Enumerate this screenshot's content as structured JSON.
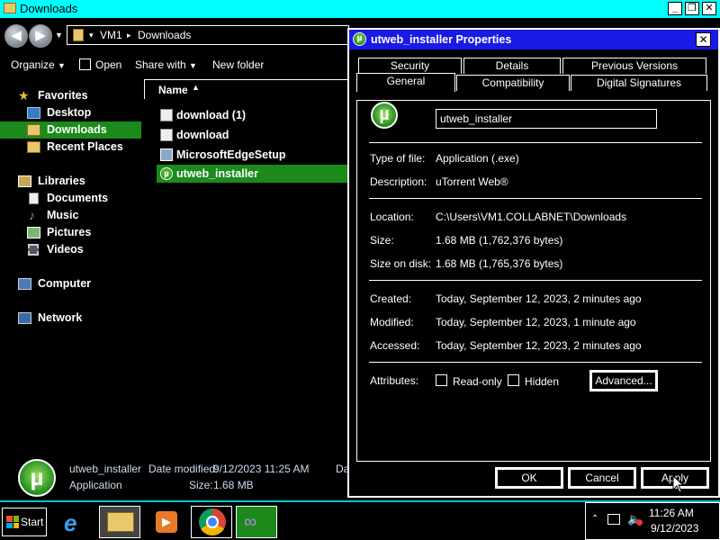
{
  "explorer": {
    "title": "Downloads",
    "breadcrumb": [
      "VM1",
      "Downloads"
    ],
    "toolbar": {
      "organize": "Organize",
      "open": "Open",
      "share_with": "Share with",
      "new_folder": "New folder"
    },
    "sidebar": {
      "favorites": "Favorites",
      "desktop": "Desktop",
      "downloads": "Downloads",
      "recent_places": "Recent Places",
      "libraries": "Libraries",
      "documents": "Documents",
      "music": "Music",
      "pictures": "Pictures",
      "videos": "Videos",
      "computer": "Computer",
      "network": "Network"
    },
    "column_header": "Name",
    "files": [
      {
        "name": "download (1)",
        "icon": "document-icon"
      },
      {
        "name": "download",
        "icon": "document-icon"
      },
      {
        "name": "MicrosoftEdgeSetup",
        "icon": "installer-icon"
      },
      {
        "name": "utweb_installer",
        "icon": "utorrent-icon",
        "selected": true
      }
    ],
    "details": {
      "name": "utweb_installer",
      "date_modified_label": "Date modified:",
      "date_modified_value": "9/12/2023 11:25 AM",
      "type": "Application",
      "size_label": "Size:",
      "size_value": "1.68 MB",
      "cut_text": "Da"
    }
  },
  "dialog": {
    "title": "utweb_installer Properties",
    "tabs_row1": [
      "Security",
      "Details",
      "Previous Versions"
    ],
    "tabs_row2": [
      "General",
      "Compatibility",
      "Digital Signatures"
    ],
    "active_tab": "General",
    "file_name": "utweb_installer",
    "type_of_file_label": "Type of file:",
    "type_of_file_value": "Application (.exe)",
    "description_label": "Description:",
    "description_value": "uTorrent Web®",
    "location_label": "Location:",
    "location_value": "C:\\Users\\VM1.COLLABNET\\Downloads",
    "size_label": "Size:",
    "size_value": "1.68 MB (1,762,376 bytes)",
    "size_on_disk_label": "Size on disk:",
    "size_on_disk_value": "1.68 MB (1,765,376 bytes)",
    "created_label": "Created:",
    "created_value": "Today, September 12, 2023, 2 minutes ago",
    "modified_label": "Modified:",
    "modified_value": "Today, September 12, 2023, 1 minute ago",
    "accessed_label": "Accessed:",
    "accessed_value": "Today, September 12, 2023, 2 minutes ago",
    "attributes_label": "Attributes:",
    "read_only_label": "Read-only",
    "hidden_label": "Hidden",
    "advanced_label": "Advanced...",
    "ok_label": "OK",
    "cancel_label": "Cancel",
    "apply_label": "Apply"
  },
  "taskbar": {
    "start_label": "Start",
    "clock_time": "11:26 AM",
    "clock_date": "9/12/2023",
    "pinned": [
      "internet-explorer-icon",
      "file-explorer-icon",
      "media-player-icon",
      "chrome-icon",
      "visual-studio-icon"
    ]
  },
  "colors": {
    "titlebar_cyan": "#00ffff",
    "selection_green": "#1b8a1b",
    "dialog_title_blue": "#1a1ae6"
  }
}
